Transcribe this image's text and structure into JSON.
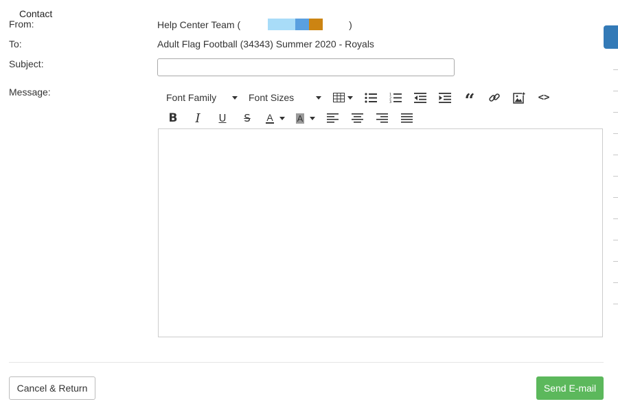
{
  "form": {
    "heading": "Contact",
    "from_label": "From:",
    "from_value_prefix": "Help Center Team (",
    "from_value_suffix": ")",
    "to_label": "To:",
    "to_value": "Adult Flag Football (34343) Summer 2020 - Royals",
    "subject_label": "Subject:",
    "subject_value": "",
    "message_label": "Message:"
  },
  "toolbar": {
    "font_family": "Font Family",
    "font_sizes": "Font Sizes",
    "code_view": "<>"
  },
  "actions": {
    "cancel_label": "Cancel & Return",
    "send_label": "Send E-mail"
  },
  "colors": {
    "send_button": "#5cb85c",
    "side_tab": "#337ab7",
    "redact_1": "#a8dcf8",
    "redact_2": "#5aa0e0",
    "redact_3": "#cc8412"
  }
}
